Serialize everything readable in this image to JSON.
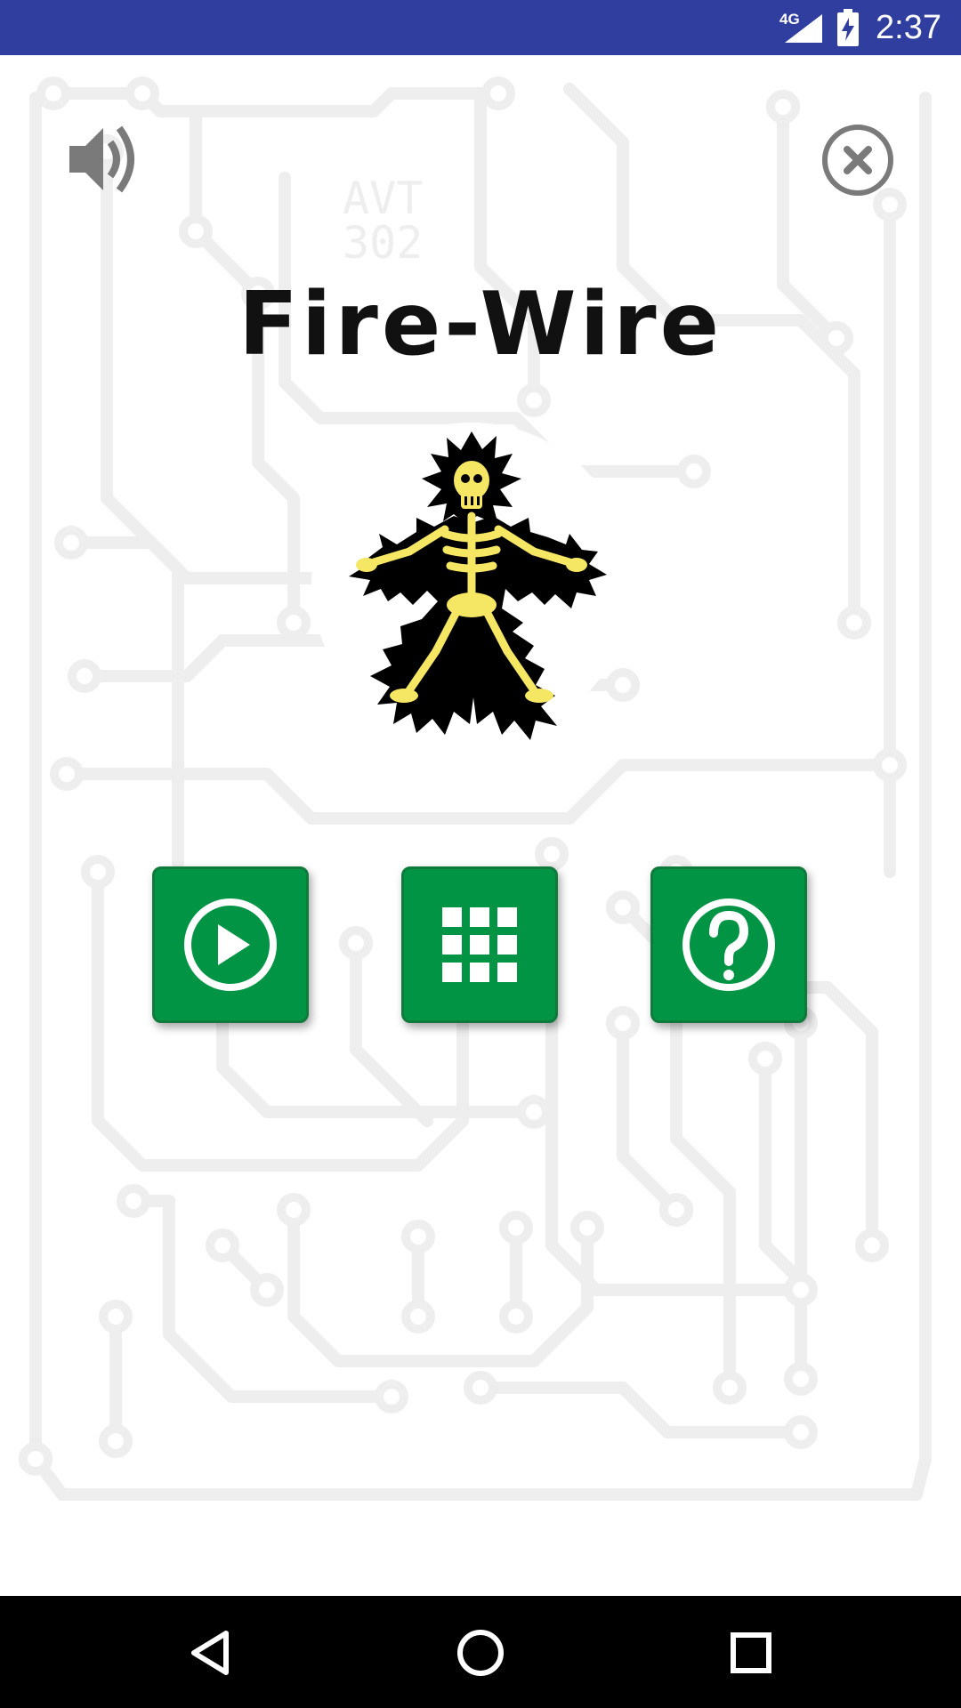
{
  "status_bar": {
    "network": "4G",
    "time": "2:37",
    "icons": [
      "signal-icon",
      "battery-charging-icon"
    ]
  },
  "board_text": {
    "line1": "AVT",
    "line2": "302"
  },
  "header": {
    "sound_icon": "speaker-icon",
    "close_icon": "close-circle-icon"
  },
  "title": "Fire-Wire",
  "menu": {
    "buttons": [
      {
        "icon": "play-icon"
      },
      {
        "icon": "level-grid-icon"
      },
      {
        "icon": "help-icon"
      }
    ]
  },
  "nav_bar": {
    "icons": [
      "back-icon",
      "home-icon",
      "recents-icon"
    ]
  },
  "colors": {
    "status_bar": "#303f9f",
    "button_green": "#009444",
    "circuit_trace": "#efefef",
    "skeleton_yellow": "#f5e663"
  }
}
